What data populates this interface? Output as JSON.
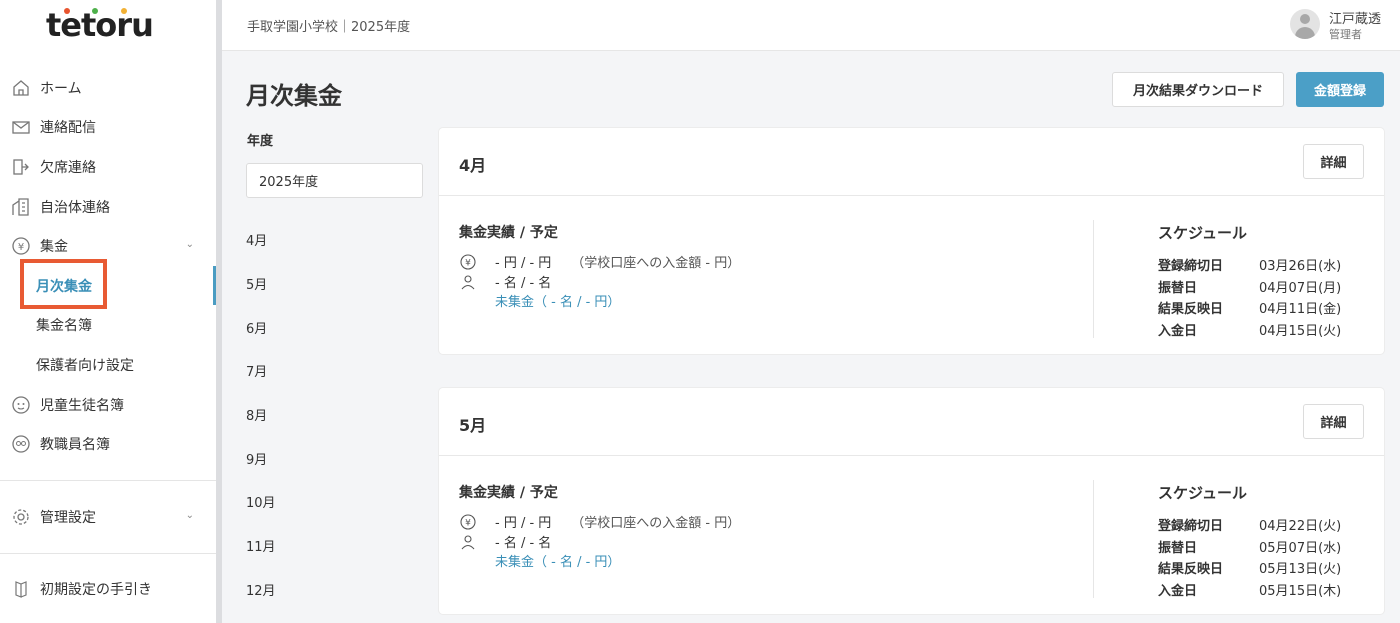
{
  "logo": {
    "text": "tetoru"
  },
  "sidebar": {
    "items": [
      {
        "label": "ホーム",
        "icon": "home-icon"
      },
      {
        "label": "連絡配信",
        "icon": "mail-icon"
      },
      {
        "label": "欠席連絡",
        "icon": "absence-icon"
      },
      {
        "label": "自治体連絡",
        "icon": "building-icon"
      },
      {
        "label": "集金",
        "icon": "yen-icon"
      }
    ],
    "subitems": [
      {
        "label": "月次集金"
      },
      {
        "label": "集金名簿"
      },
      {
        "label": "保護者向け設定"
      }
    ],
    "items2": [
      {
        "label": "児童生徒名簿",
        "icon": "student-icon"
      },
      {
        "label": "教職員名簿",
        "icon": "teacher-icon"
      }
    ],
    "settings_label": "管理設定",
    "guide_label": "初期設定の手引き"
  },
  "header": {
    "school": "手取学園小学校｜2025年度",
    "user_name": "江戸蔵透",
    "user_role": "管理者"
  },
  "main": {
    "title": "月次集金",
    "download_label": "月次結果ダウンロード",
    "register_label": "金額登録",
    "year_label": "年度",
    "year_value": "2025年度",
    "months": [
      "4月",
      "5月",
      "6月",
      "7月",
      "8月",
      "9月",
      "10月",
      "11月",
      "12月"
    ]
  },
  "cards": [
    {
      "month": "4月",
      "detail_label": "詳細",
      "section_title": "集金実績 / 予定",
      "amount": "- 円 / - 円",
      "note": "（学校口座への入金額 - 円）",
      "people": "- 名 / - 名",
      "uncollected": "未集金（ - 名 / - 円）",
      "schedule_title": "スケジュール",
      "schedule": [
        {
          "key": "登録締切日",
          "value": "03月26日(水)"
        },
        {
          "key": "振替日",
          "value": "04月07日(月)"
        },
        {
          "key": "結果反映日",
          "value": "04月11日(金)"
        },
        {
          "key": "入金日",
          "value": "04月15日(火)"
        }
      ]
    },
    {
      "month": "5月",
      "detail_label": "詳細",
      "section_title": "集金実績 / 予定",
      "amount": "- 円 / - 円",
      "note": "（学校口座への入金額 - 円）",
      "people": "- 名 / - 名",
      "uncollected": "未集金（ - 名 / - 円）",
      "schedule_title": "スケジュール",
      "schedule": [
        {
          "key": "登録締切日",
          "value": "04月22日(火)"
        },
        {
          "key": "振替日",
          "value": "05月07日(水)"
        },
        {
          "key": "結果反映日",
          "value": "05月13日(火)"
        },
        {
          "key": "入金日",
          "value": "05月15日(木)"
        }
      ]
    }
  ]
}
